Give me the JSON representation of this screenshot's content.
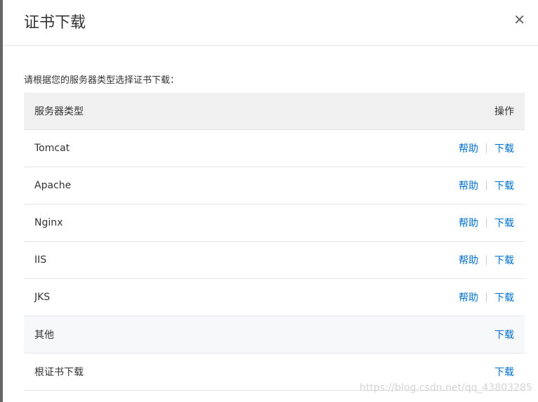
{
  "dialog": {
    "title": "证书下载",
    "close_icon": "close-icon"
  },
  "intro": "请根据您的服务器类型选择证书下载：",
  "table": {
    "headers": {
      "type": "服务器类型",
      "actions": "操作"
    },
    "rows": [
      {
        "name": "Tomcat",
        "help": "帮助",
        "download": "下载"
      },
      {
        "name": "Apache",
        "help": "帮助",
        "download": "下载"
      },
      {
        "name": "Nginx",
        "help": "帮助",
        "download": "下载"
      },
      {
        "name": "IIS",
        "help": "帮助",
        "download": "下载"
      },
      {
        "name": "JKS",
        "help": "帮助",
        "download": "下载"
      },
      {
        "name": "其他",
        "download": "下载"
      },
      {
        "name": "根证书下载",
        "download": "下载"
      }
    ]
  },
  "watermark": "https://blog.csdn.net/qq_43803285",
  "colors": {
    "link": "#0070cc",
    "header_bg": "#f0f0f0"
  }
}
